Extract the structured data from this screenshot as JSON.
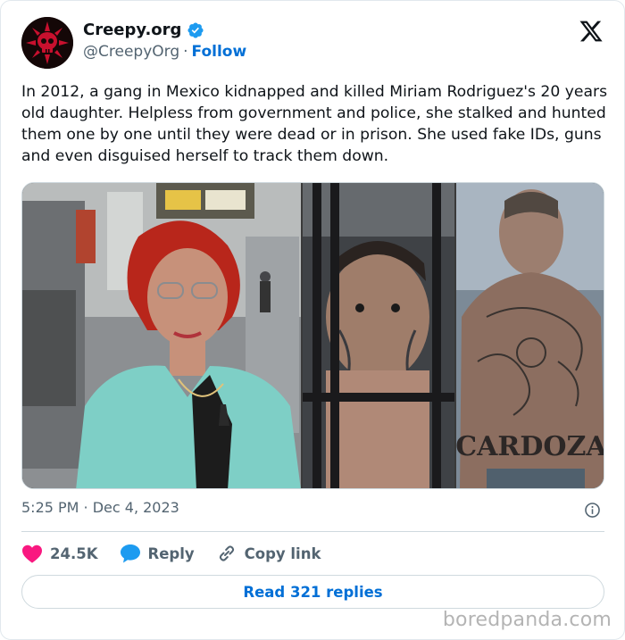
{
  "author": {
    "display_name": "Creepy.org",
    "handle": "@CreepyOrg",
    "separator": "·",
    "follow_label": "Follow",
    "avatar_icon": "skull-logo-icon",
    "verified_icon": "verified-badge-icon",
    "verified_color": "#1d9bf0"
  },
  "tweet": {
    "text": "In 2012, a gang in Mexico kidnapped and killed Miriam Rodriguez's 20 years old daughter. Helpless from government and police, she stalked and hunted them one by one until they were dead or in prison. She used fake IDs, guns and even disguised herself to track them down."
  },
  "meta": {
    "timestamp": "5:25 PM · Dec 4, 2023"
  },
  "actions": {
    "likes_count": "24.5K",
    "reply_label": "Reply",
    "copy_link_label": "Copy link",
    "like_color": "#f91880",
    "reply_color": "#1d9bf0"
  },
  "read_replies_label": "Read 321 replies",
  "media_tattoo_text": "CARDOZA",
  "watermark": "boredpanda.com",
  "colors": {
    "link_blue": "#006fd6",
    "muted": "#536471",
    "border": "#cfd9de"
  }
}
